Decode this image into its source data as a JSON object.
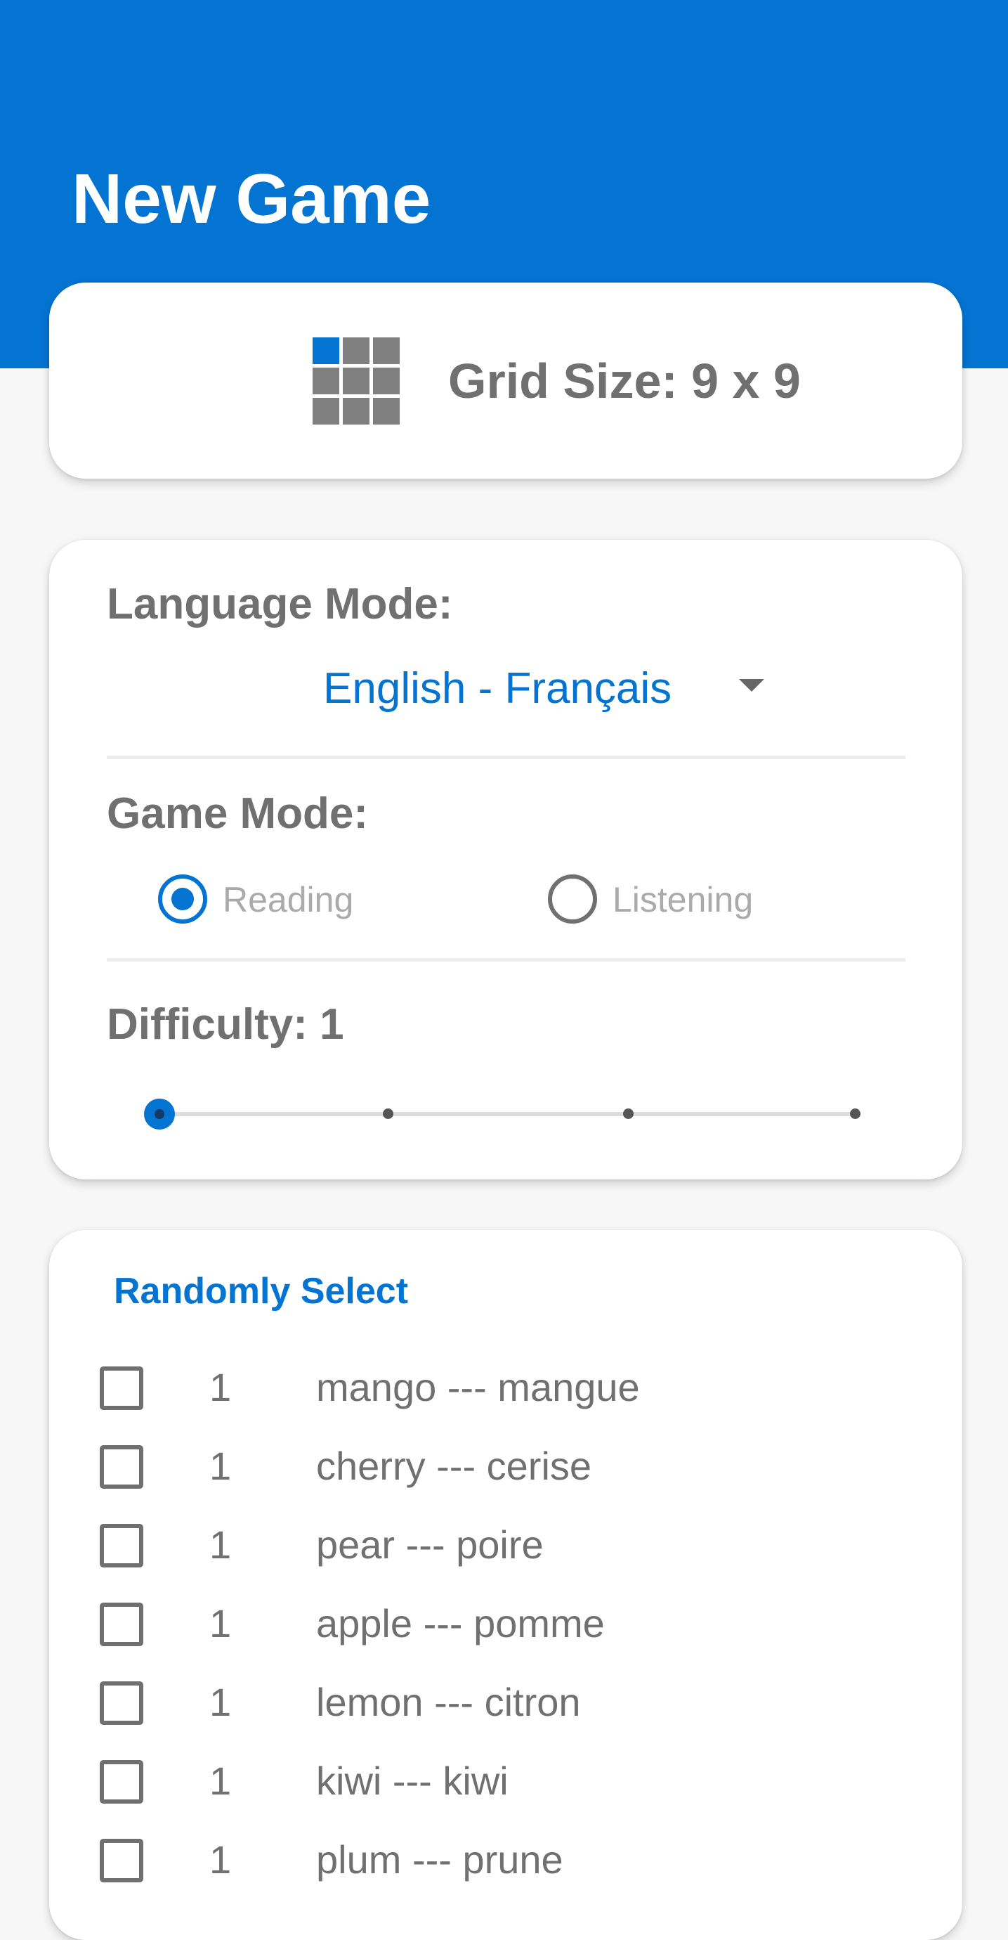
{
  "header": {
    "title": "New Game"
  },
  "grid": {
    "label": "Grid Size: 9 x 9",
    "icon": "grid-icon"
  },
  "settings": {
    "language_label": "Language Mode:",
    "language_value": "English - Français",
    "game_mode_label": "Game Mode:",
    "game_modes": [
      {
        "label": "Reading",
        "selected": true
      },
      {
        "label": "Listening",
        "selected": false
      }
    ],
    "difficulty_label": "Difficulty: 1",
    "difficulty": {
      "value": 1,
      "min": 1,
      "max": 4,
      "steps": [
        1,
        2,
        3,
        4
      ]
    }
  },
  "words": {
    "random_select_label": "Randomly Select",
    "items": [
      {
        "count": "1",
        "text": "mango --- mangue",
        "checked": false
      },
      {
        "count": "1",
        "text": "cherry --- cerise",
        "checked": false
      },
      {
        "count": "1",
        "text": "pear --- poire",
        "checked": false
      },
      {
        "count": "1",
        "text": "apple --- pomme",
        "checked": false
      },
      {
        "count": "1",
        "text": "lemon --- citron",
        "checked": false
      },
      {
        "count": "1",
        "text": "kiwi --- kiwi",
        "checked": false
      },
      {
        "count": "1",
        "text": "plum --- prune",
        "checked": false
      }
    ]
  },
  "colors": {
    "primary": "#0474d2",
    "text_gray": "#707070",
    "radio_label_gray": "#aaaaaa",
    "background": "#f7f7f7",
    "grid_icon_gray": "#808080"
  }
}
